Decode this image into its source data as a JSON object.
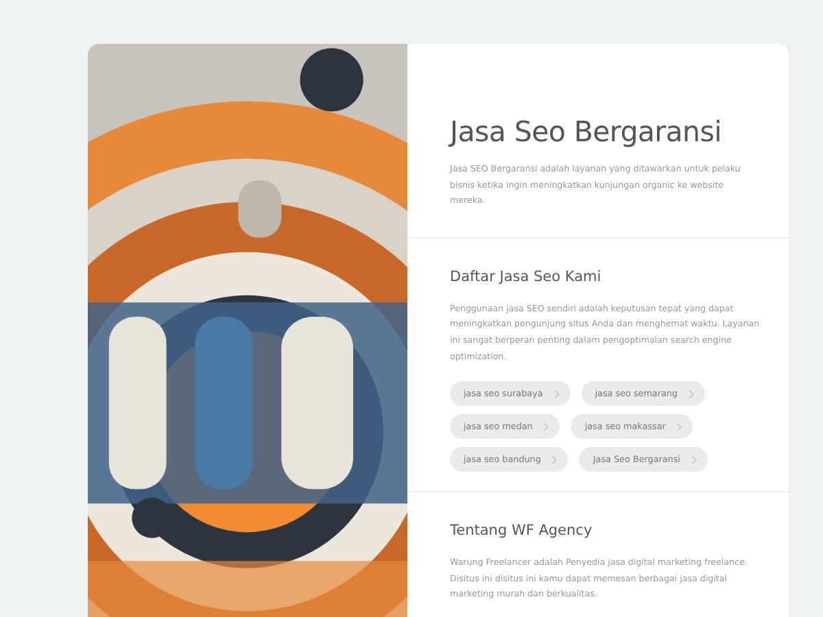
{
  "intro": {
    "title": "Jasa Seo Bergaransi",
    "text": "Jasa SEO Bergaransi adalah layanan yang ditawarkan untuk pelaku bisnis ketika ingin meningkatkan kunjungan organic ke website mereka."
  },
  "services": {
    "heading": "Daftar Jasa Seo Kami",
    "text": "Penggunaan jasa SEO sendiri adalah keputusan tepat yang dapat meningkatkan pengunjung situs Anda dan menghemat waktu. Layanan ini sangat berperan penting dalam pengoptimalan search engine optimization.",
    "chips": [
      {
        "label": "jasa seo surabaya"
      },
      {
        "label": "jasa seo semarang"
      },
      {
        "label": "jasa seo medan"
      },
      {
        "label": "jasa seo makassar"
      },
      {
        "label": "jasa seo bandung"
      },
      {
        "label": "Jasa Seo Bergaransi"
      }
    ]
  },
  "about": {
    "heading": "Tentang WF Agency",
    "text": "Warung Freelancer adalah Penyedia jasa digital marketing freelance. Disitus ini disitus ini kamu dapat memesan berbagai jasa digital marketing murah dan berkualitas."
  }
}
